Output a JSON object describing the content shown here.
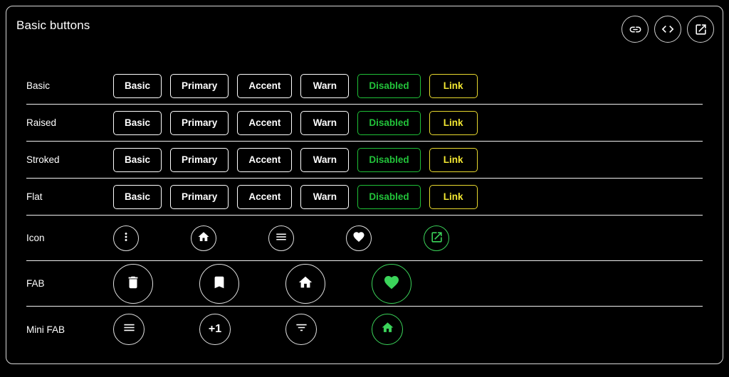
{
  "card": {
    "title": "Basic buttons",
    "header_actions": [
      {
        "name": "link-icon",
        "label": "Link"
      },
      {
        "name": "code-icon",
        "label": "View source"
      },
      {
        "name": "open-in-new-icon",
        "label": "Open in new window"
      }
    ]
  },
  "colors": {
    "background": "#000000",
    "border": "#d8d8d8",
    "text": "#ffffff",
    "accent_green": "#3bd45a",
    "disabled_green": "#22c33a",
    "link_yellow": "#f2e732"
  },
  "rows": {
    "basic": {
      "label": "Basic",
      "buttons": [
        {
          "label": "Basic",
          "variant": "default"
        },
        {
          "label": "Primary",
          "variant": "default"
        },
        {
          "label": "Accent",
          "variant": "default"
        },
        {
          "label": "Warn",
          "variant": "default"
        },
        {
          "label": "Disabled",
          "variant": "disabled"
        },
        {
          "label": "Link",
          "variant": "link"
        }
      ]
    },
    "raised": {
      "label": "Raised",
      "buttons": [
        {
          "label": "Basic",
          "variant": "default"
        },
        {
          "label": "Primary",
          "variant": "default"
        },
        {
          "label": "Accent",
          "variant": "default"
        },
        {
          "label": "Warn",
          "variant": "default"
        },
        {
          "label": "Disabled",
          "variant": "disabled"
        },
        {
          "label": "Link",
          "variant": "link"
        }
      ]
    },
    "stroked": {
      "label": "Stroked",
      "buttons": [
        {
          "label": "Basic",
          "variant": "default"
        },
        {
          "label": "Primary",
          "variant": "default"
        },
        {
          "label": "Accent",
          "variant": "default"
        },
        {
          "label": "Warn",
          "variant": "default"
        },
        {
          "label": "Disabled",
          "variant": "disabled"
        },
        {
          "label": "Link",
          "variant": "link"
        }
      ]
    },
    "flat": {
      "label": "Flat",
      "buttons": [
        {
          "label": "Basic",
          "variant": "default"
        },
        {
          "label": "Primary",
          "variant": "default"
        },
        {
          "label": "Accent",
          "variant": "default"
        },
        {
          "label": "Warn",
          "variant": "default"
        },
        {
          "label": "Disabled",
          "variant": "disabled"
        },
        {
          "label": "Link",
          "variant": "link"
        }
      ]
    },
    "icon": {
      "label": "Icon",
      "buttons": [
        {
          "icon": "more-vert-icon",
          "accent": false
        },
        {
          "icon": "home-icon",
          "accent": false
        },
        {
          "icon": "menu-icon",
          "accent": false
        },
        {
          "icon": "favorite-icon",
          "accent": false
        },
        {
          "icon": "open-in-new-icon",
          "accent": true
        }
      ]
    },
    "fab": {
      "label": "FAB",
      "buttons": [
        {
          "icon": "delete-icon",
          "accent": false
        },
        {
          "icon": "bookmark-icon",
          "accent": false
        },
        {
          "icon": "home-icon",
          "accent": false
        },
        {
          "icon": "favorite-icon",
          "accent": true
        }
      ]
    },
    "mini_fab": {
      "label": "Mini FAB",
      "buttons": [
        {
          "icon": "menu-icon",
          "accent": false
        },
        {
          "icon": "plus-one-icon",
          "accent": false,
          "text": "+1"
        },
        {
          "icon": "filter-list-icon",
          "accent": false
        },
        {
          "icon": "home-icon",
          "accent": true
        }
      ]
    }
  }
}
